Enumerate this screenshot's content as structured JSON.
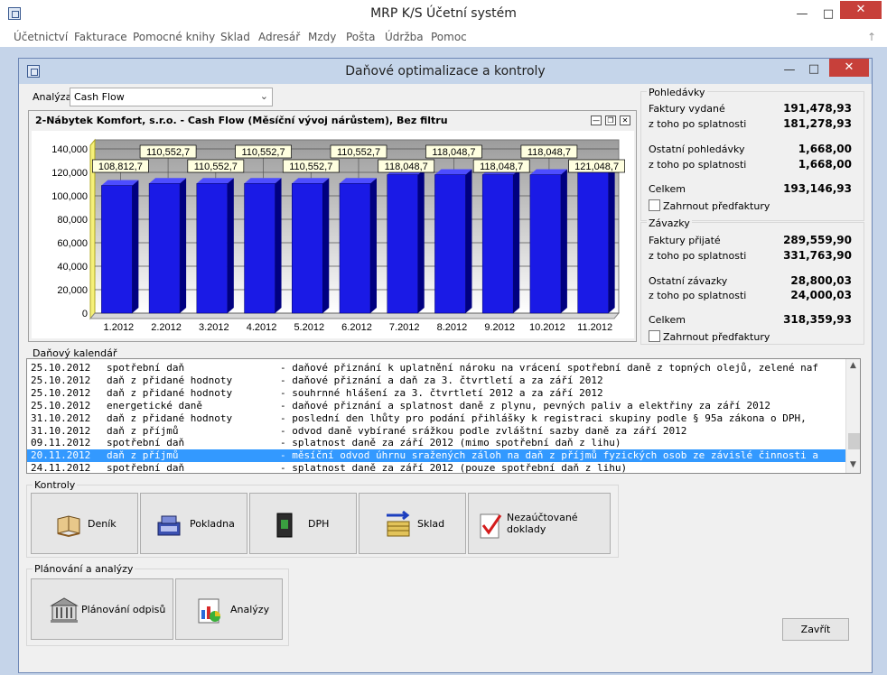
{
  "app": {
    "title": "MRP K/S Účetní systém",
    "menu": [
      "Účetnictví",
      "Fakturace",
      "Pomocné knihy",
      "Sklad",
      "Adresář",
      "Mzdy",
      "Pošta",
      "Údržba",
      "Pomoc"
    ]
  },
  "dialog": {
    "title": "Daňové optimalizace a kontroly"
  },
  "analysis": {
    "label": "Analýza",
    "selected": "Cash Flow"
  },
  "chart_panel": {
    "title": "2-Nábytek Komfort, s.r.o. - Cash Flow (Měsíční vývoj nárůstem), Bez filtru"
  },
  "chart_data": {
    "type": "bar",
    "title": "2-Nábytek Komfort, s.r.o. - Cash Flow (Měsíční vývoj nárůstem), Bez filtru",
    "categories": [
      "1.2012",
      "2.2012",
      "3.2012",
      "4.2012",
      "5.2012",
      "6.2012",
      "7.2012",
      "8.2012",
      "9.2012",
      "10.2012",
      "11.2012"
    ],
    "values": [
      108812.7,
      110552.7,
      110552.7,
      110552.7,
      110552.7,
      110552.7,
      118048.7,
      118048.7,
      118048.7,
      118048.7,
      121048.7
    ],
    "data_labels": [
      "108,812,7",
      "110,552,7",
      "110,552,7",
      "110,552,7",
      "110,552,7",
      "110,552,7",
      "118,048,7",
      "118,048,7",
      "118,048,7",
      "118,048,7",
      "121,048,7"
    ],
    "yticks": [
      "0",
      "20,000",
      "40,000",
      "60,000",
      "80,000",
      "100,000",
      "120,000",
      "140,000"
    ],
    "ylim": [
      0,
      140000
    ],
    "bar_color": "#1a1ae6",
    "grid": true
  },
  "receivables": {
    "heading": "Pohledávky",
    "rows": [
      {
        "label": "Faktury vydané",
        "value": "191,478,93"
      },
      {
        "label": "z toho po splatnosti",
        "value": "181,278,93"
      },
      {
        "label": "Ostatní pohledávky",
        "value": "1,668,00"
      },
      {
        "label": "z toho po splatnosti",
        "value": "1,668,00"
      },
      {
        "label": "Celkem",
        "value": "193,146,93"
      }
    ],
    "checkbox": "Zahrnout předfaktury"
  },
  "payables": {
    "heading": "Závazky",
    "rows": [
      {
        "label": "Faktury přijaté",
        "value": "289,559,90"
      },
      {
        "label": "z toho po splatnosti",
        "value": "331,763,90"
      },
      {
        "label": "Ostatní závazky",
        "value": "28,800,03"
      },
      {
        "label": "z toho po splatnosti",
        "value": "24,000,03"
      },
      {
        "label": "Celkem",
        "value": "318,359,93"
      }
    ],
    "checkbox": "Zahrnout předfaktury"
  },
  "calendar": {
    "heading": "Daňový kalendář",
    "rows": [
      {
        "date": "25.10.2012",
        "type": "spotřební daň",
        "desc": "- daňové přiznání k uplatnění nároku na vrácení spotřební daně z topných olejů, zelené naf"
      },
      {
        "date": "25.10.2012",
        "type": "daň z přidané hodnoty",
        "desc": "- daňové přiznání a daň za 3. čtvrtletí a za září 2012"
      },
      {
        "date": "25.10.2012",
        "type": "daň z přidané hodnoty",
        "desc": "- souhrnné hlášení za 3. čtvrtletí 2012 a za září 2012"
      },
      {
        "date": "25.10.2012",
        "type": "energetické daně",
        "desc": "- daňové přiznání a splatnost daně z plynu, pevných paliv a elektřiny za září 2012"
      },
      {
        "date": "31.10.2012",
        "type": "daň z přidané hodnoty",
        "desc": "- poslední den lhůty pro podání přihlášky k registraci skupiny podle § 95a zákona o DPH,"
      },
      {
        "date": "31.10.2012",
        "type": "daň z příjmů",
        "desc": "- odvod daně vybírané srážkou podle zvláštní sazby daně za září 2012"
      },
      {
        "date": "09.11.2012",
        "type": "spotřební daň",
        "desc": "- splatnost daně za září 2012 (mimo spotřební daň z lihu)"
      },
      {
        "date": "20.11.2012",
        "type": "daň z příjmů",
        "desc": "- měsíční odvod úhrnu sražených záloh na daň z příjmů fyzických osob ze závislé činnosti a"
      },
      {
        "date": "24.11.2012",
        "type": "spotřební daň",
        "desc": "- splatnost daně za září 2012 (pouze spotřební daň z lihu)"
      }
    ],
    "selected_index": 7
  },
  "controls": {
    "heading": "Kontroly",
    "buttons": [
      "Deník",
      "Pokladna",
      "DPH",
      "Sklad",
      "Nezaúčtované doklady"
    ]
  },
  "planning": {
    "heading": "Plánování a analýzy",
    "buttons": [
      "Plánování odpisů",
      "Analýzy"
    ]
  },
  "close_label": "Zavřít",
  "colors": {
    "selection": "#3399ff",
    "accent": "#c5d4e9"
  }
}
